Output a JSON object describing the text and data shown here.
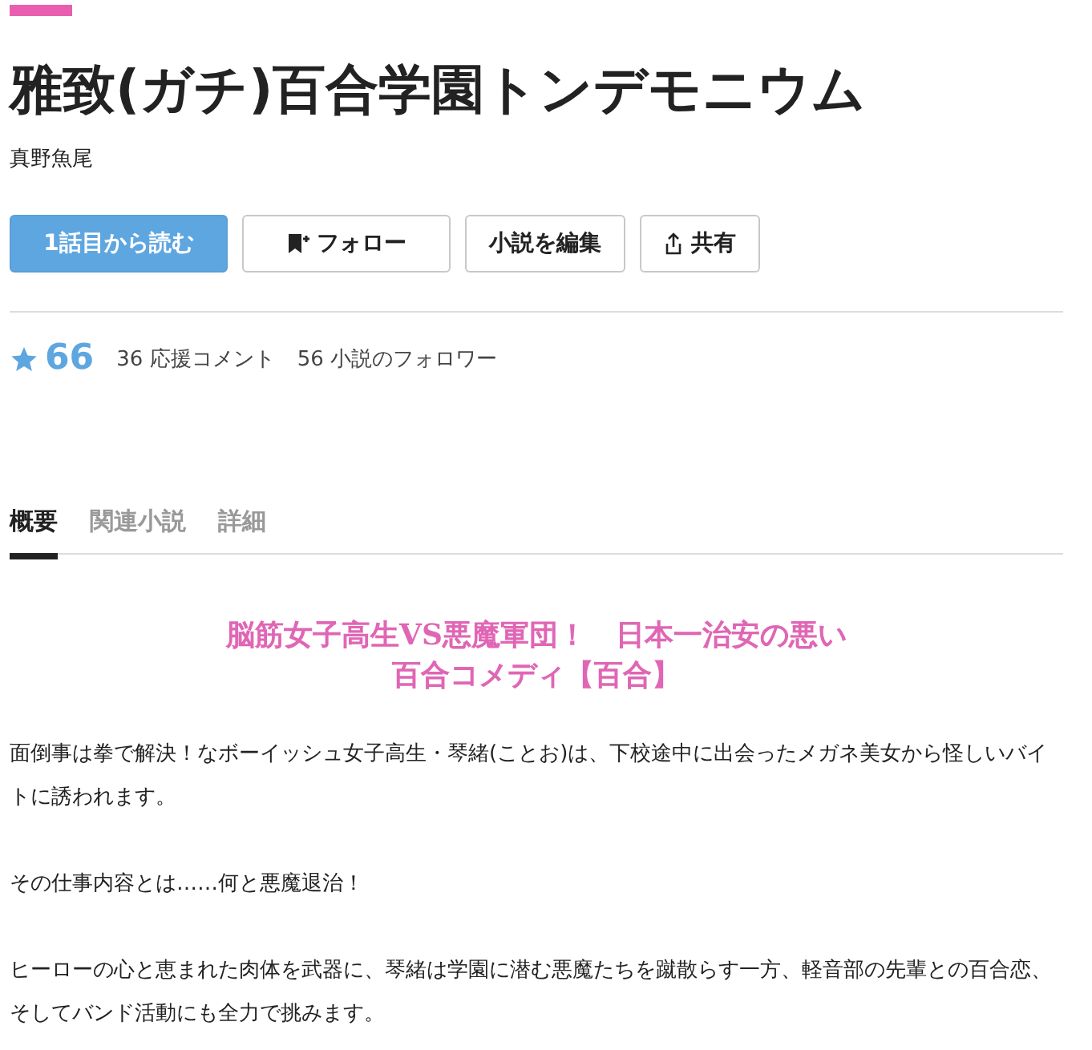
{
  "title": "雅致(ガチ)百合学園トンデモニウム",
  "author": "真野魚尾",
  "buttons": [
    {
      "kind": "primary",
      "label": "1話目から読む"
    },
    {
      "kind": "follow",
      "label": "フォロー"
    },
    {
      "kind": "plain",
      "label": "小説を編集"
    },
    {
      "kind": "share",
      "label": "共有"
    }
  ],
  "stats": {
    "stars": "66",
    "comments": "36 応援コメント",
    "followers": "56 小説のフォロワー"
  },
  "tabs": [
    {
      "label": "概要",
      "selected": true
    },
    {
      "label": "関連小説",
      "selected": false
    },
    {
      "label": "詳細",
      "selected": false
    }
  ],
  "catchphrase": [
    "脳筋女子高生VS悪魔軍団！　日本一治安の悪い",
    "百合コメディ【百合】"
  ],
  "paragraphs": [
    "面倒事は拳で解決！なボーイッシュ女子高生・琴緒(ことお)は、下校途中に出会ったメガネ美女から怪しいバイトに誘われます。",
    "その仕事内容とは……何と悪魔退治！",
    "ヒーローの心と恵まれた肉体を武器に、琴緒は学園に潜む悪魔たちを蹴散らす一方、軽音部の先輩との百合恋、そしてバンド活動にも全力で挑みます。"
  ]
}
